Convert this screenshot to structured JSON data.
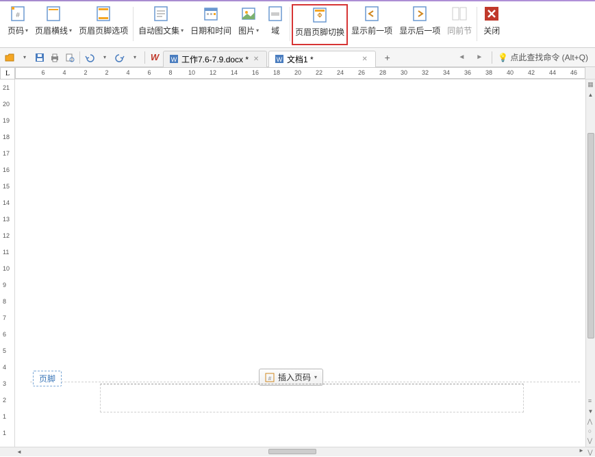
{
  "ribbon": {
    "page_number": "页码",
    "header_line": "页眉横线",
    "header_footer_options": "页眉页脚选项",
    "auto_text": "自动图文集",
    "date_time": "日期和时间",
    "picture": "图片",
    "field": "域",
    "header_footer_switch": "页眉页脚切换",
    "show_prev": "显示前一项",
    "show_next": "显示后一项",
    "same_prev_section": "同前节",
    "close": "关闭"
  },
  "tabs": {
    "doc1": "工作7.6-7.9.docx *",
    "doc2": "文档1 *"
  },
  "find_command": "点此查找命令 (Alt+Q)",
  "ruler_corner": "L",
  "footer_label": "页脚",
  "insert_page_number": "插入页码",
  "h_ruler": [
    6,
    4,
    2,
    2,
    4,
    6,
    8,
    10,
    12,
    14,
    16,
    18,
    20,
    22,
    24,
    26,
    28,
    30,
    32,
    34,
    36,
    38,
    40,
    42,
    44,
    46
  ],
  "v_ruler": [
    21,
    20,
    19,
    18,
    17,
    16,
    15,
    14,
    13,
    12,
    11,
    10,
    9,
    8,
    7,
    6,
    5,
    4,
    3,
    2,
    1,
    1
  ]
}
